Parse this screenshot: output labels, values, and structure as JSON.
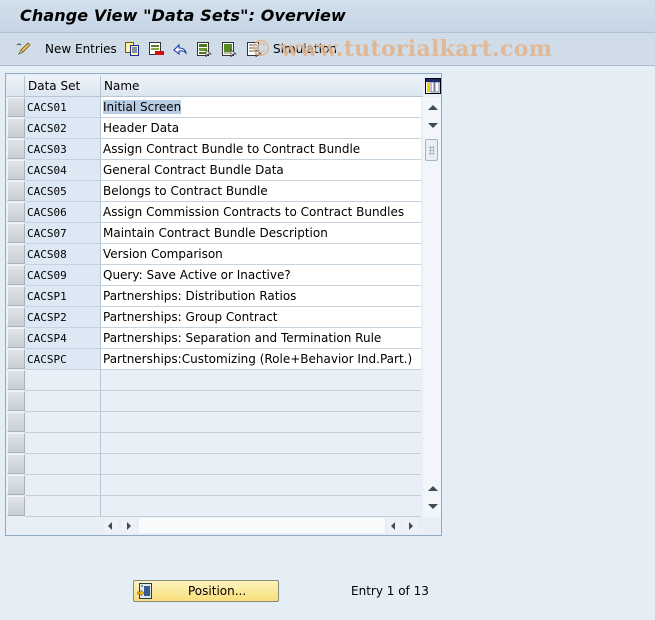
{
  "window": {
    "title": "Change View \"Data Sets\": Overview"
  },
  "toolbar": {
    "items": [
      {
        "icon": "edit-pencil-icon",
        "label": ""
      },
      {
        "icon": "new-entries",
        "label": "New Entries"
      },
      {
        "icon": "copy-icon",
        "label": ""
      },
      {
        "icon": "delete-icon",
        "label": ""
      },
      {
        "icon": "undo-icon",
        "label": ""
      },
      {
        "icon": "select-all-icon",
        "label": ""
      },
      {
        "icon": "select-block-icon",
        "label": ""
      },
      {
        "icon": "deselect-all-icon",
        "label": ""
      },
      {
        "icon": "simulation",
        "label": "Simulation"
      }
    ],
    "new_entries_label": "New Entries",
    "simulation_label": "Simulation"
  },
  "watermark": "© www.tutorialkart.com",
  "table": {
    "columns": [
      "Data Set",
      "Name"
    ],
    "rows": [
      {
        "data_set": "CACS01",
        "name": "Initial Screen"
      },
      {
        "data_set": "CACS02",
        "name": "Header Data"
      },
      {
        "data_set": "CACS03",
        "name": "Assign Contract Bundle to Contract Bundle"
      },
      {
        "data_set": "CACS04",
        "name": "General Contract Bundle Data"
      },
      {
        "data_set": "CACS05",
        "name": "Belongs to Contract Bundle"
      },
      {
        "data_set": "CACS06",
        "name": "Assign Commission Contracts to Contract Bundles"
      },
      {
        "data_set": "CACS07",
        "name": "Maintain Contract Bundle Description"
      },
      {
        "data_set": "CACS08",
        "name": "Version Comparison"
      },
      {
        "data_set": "CACS09",
        "name": "Query: Save Active or Inactive?"
      },
      {
        "data_set": "CACSP1",
        "name": "Partnerships: Distribution Ratios"
      },
      {
        "data_set": "CACSP2",
        "name": "Partnerships: Group Contract"
      },
      {
        "data_set": "CACSP4",
        "name": "Partnerships: Separation and Termination Rule"
      },
      {
        "data_set": "CACSPC",
        "name": "Partnerships:Customizing (Role+Behavior Ind.Part.)"
      }
    ],
    "empty_rows": 7,
    "highlighted_cell": "Initial Screen"
  },
  "footer": {
    "position_button_label": "Position...",
    "entry_text": "Entry 1 of 13"
  },
  "colors": {
    "title_bg": "#c9d9e9",
    "toolbar_bg": "#d0dce8",
    "body_bg": "#e5edf5",
    "selection_highlight": "#b8cde3",
    "button_yellow": "#f8df7a",
    "watermark": "#e2b48a"
  }
}
